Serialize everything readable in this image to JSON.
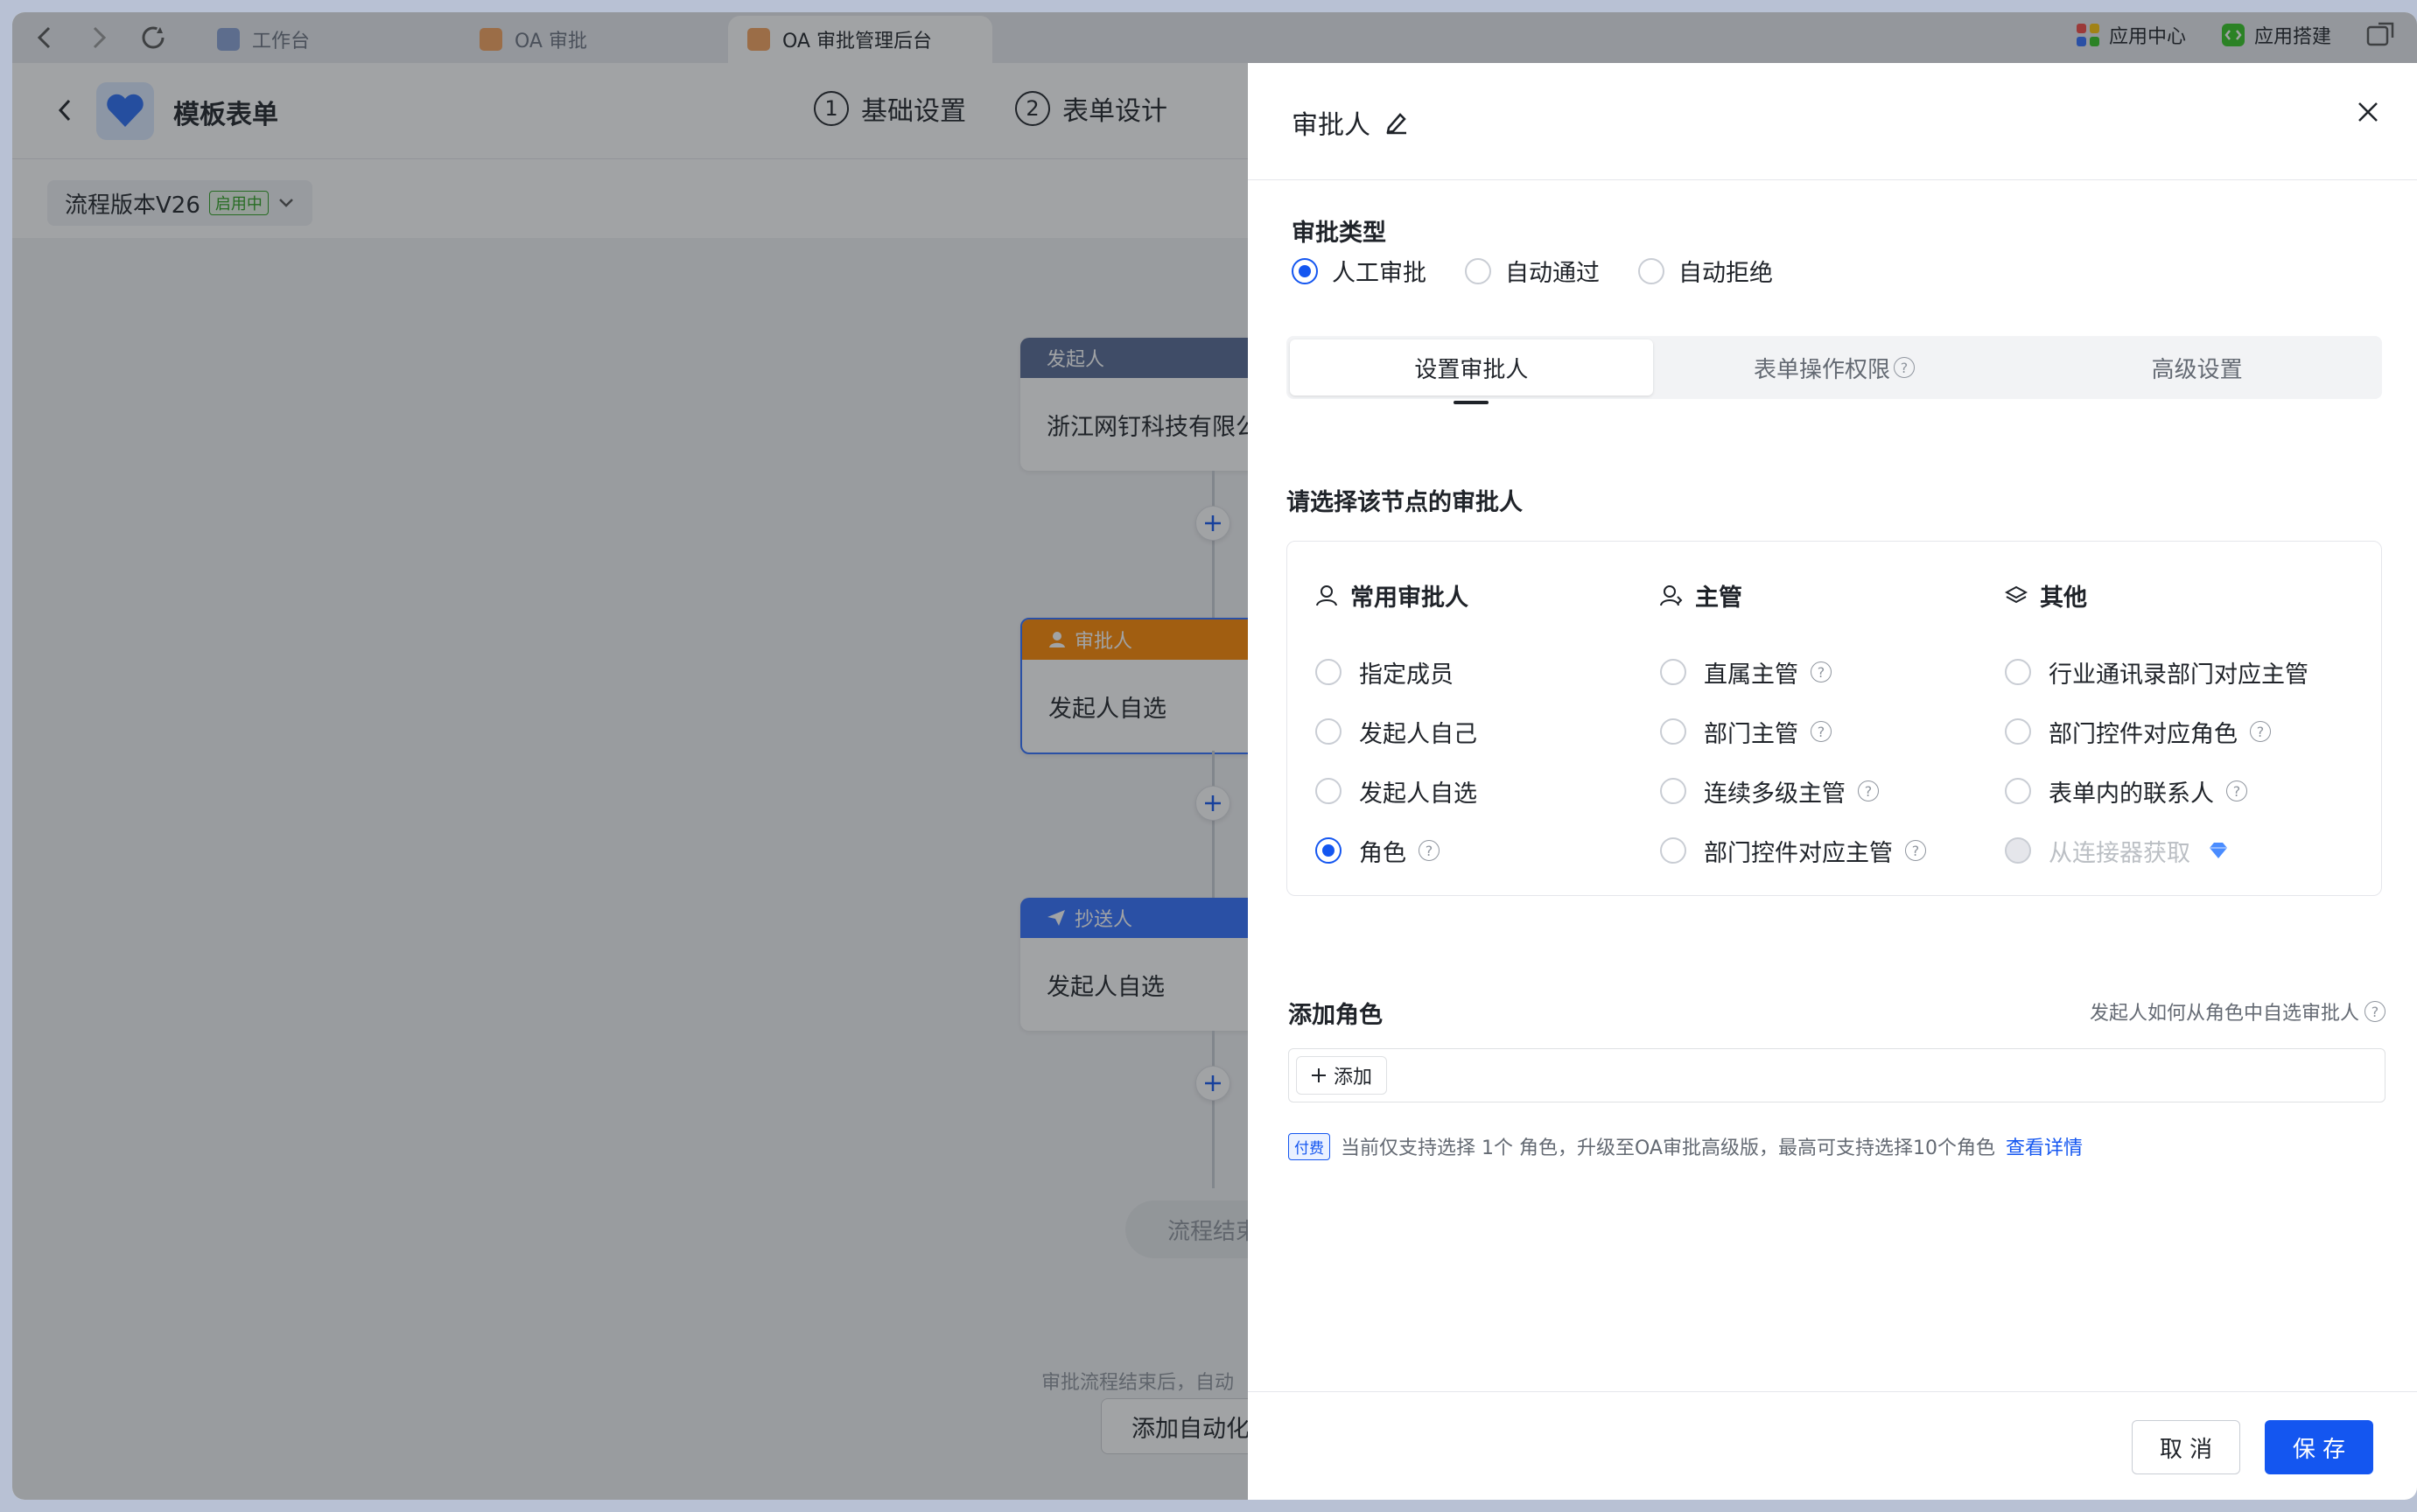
{
  "browser": {
    "tabs": [
      {
        "label": "工作台"
      },
      {
        "label": "OA 审批"
      },
      {
        "label": "OA 审批管理后台"
      }
    ],
    "app_center": "应用中心",
    "app_builder": "应用搭建"
  },
  "header": {
    "title": "模板表单",
    "steps": [
      {
        "num": "1",
        "label": "基础设置"
      },
      {
        "num": "2",
        "label": "表单设计"
      }
    ]
  },
  "version": {
    "label": "流程版本V26",
    "status": "启用中"
  },
  "flow": {
    "initiator": {
      "header": "发起人",
      "body": "浙江网钉科技有限公"
    },
    "approver": {
      "header": "审批人",
      "body": "发起人自选"
    },
    "cc": {
      "header": "抄送人",
      "body": "发起人自选"
    },
    "end": "流程结束",
    "footnote": "审批流程结束后，自动",
    "automation_button": "添加自动化"
  },
  "drawer": {
    "title": "审批人",
    "approval_type_title": "审批类型",
    "approval_types": [
      {
        "label": "人工审批",
        "checked": true
      },
      {
        "label": "自动通过",
        "checked": false
      },
      {
        "label": "自动拒绝",
        "checked": false
      }
    ],
    "tabs": [
      {
        "label": "设置审批人"
      },
      {
        "label": "表单操作权限"
      },
      {
        "label": "高级设置"
      }
    ],
    "select_title": "请选择该节点的审批人",
    "columns": {
      "common": {
        "title": "常用审批人",
        "options": [
          {
            "label": "指定成员"
          },
          {
            "label": "发起人自己"
          },
          {
            "label": "发起人自选"
          },
          {
            "label": "角色"
          }
        ]
      },
      "manager": {
        "title": "主管",
        "options": [
          {
            "label": "直属主管"
          },
          {
            "label": "部门主管"
          },
          {
            "label": "连续多级主管"
          },
          {
            "label": "部门控件对应主管"
          }
        ]
      },
      "other": {
        "title": "其他",
        "options": [
          {
            "label": "行业通讯录部门对应主管"
          },
          {
            "label": "部门控件对应角色"
          },
          {
            "label": "表单内的联系人"
          },
          {
            "label": "从连接器获取"
          }
        ]
      }
    },
    "roles": {
      "title": "添加角色",
      "hint": "发起人如何从角色中自选审批人",
      "add_label": "添加",
      "pay_tag": "付费",
      "pay_note": "当前仅支持选择 1个 角色，升级至OA审批高级版，最高可支持选择10个角色",
      "pay_link": "查看详情"
    },
    "cancel": "取 消",
    "save": "保 存"
  },
  "colors": {
    "accent": "#1456f0",
    "approver_header": "#ff8800",
    "cc_header": "#3370ff",
    "initiator_header": "#576a95"
  }
}
